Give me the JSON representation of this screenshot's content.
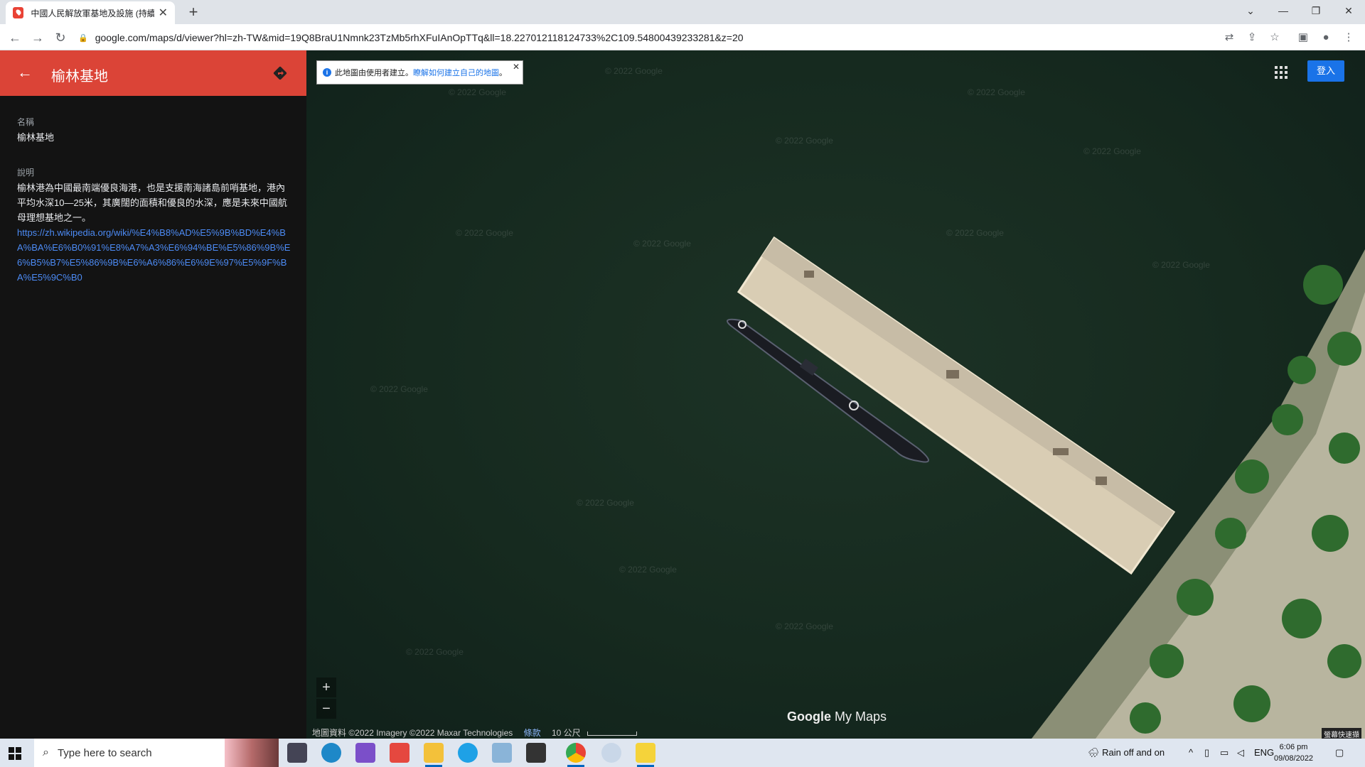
{
  "browser": {
    "tab_title": "中國人民解放軍基地及設施 (持續",
    "tab_close": "✕",
    "new_tab": "+",
    "url": "google.com/maps/d/viewer?hl=zh-TW&mid=19Q8BraU1Nmnk23TzMb5rhXFuIAnOpTTq&ll=18.227012118124733%2C109.54800439233281&z=20",
    "win_controls": [
      "⌄",
      "—",
      "❐",
      "✕"
    ]
  },
  "panel": {
    "title": "榆林基地",
    "name_label": "名稱",
    "name_value": "榆林基地",
    "desc_label": "說明",
    "desc_text": "榆林港為中國最南端優良海港，也是支援南海諸島前哨基地，港內平均水深10—25米，其廣闊的面積和優良的水深，應是未來中國航母理想基地之一。",
    "desc_link": "https://zh.wikipedia.org/wiki/%E4%B8%AD%E5%9B%BD%E4%BA%BA%E6%B0%91%E8%A7%A3%E6%94%BE%E5%86%9B%E6%B5%B7%E5%86%9B%E6%A6%86%E6%9E%97%E5%9F%BA%E5%9C%B0"
  },
  "map": {
    "info_text": "此地圖由使用者建立。",
    "info_link": "瞭解如何建立自己的地圖",
    "info_tail": "。",
    "signin_label": "登入",
    "zoom_in": "+",
    "zoom_out": "−",
    "attribution": "地圖資料 ©2022 Imagery ©2022 Maxar Technologies",
    "terms": "條款",
    "scale": "10 公尺",
    "logo_google": "Google",
    "logo_mymaps": "My Maps",
    "watermark": "© 2022 Google",
    "corner_badge": "螢幕快速擷"
  },
  "taskbar": {
    "search_placeholder": "Type here to search",
    "weather": "Rain off and on",
    "lang": "ENG",
    "time": "6:06 pm",
    "date": "09/08/2022"
  },
  "colors": {
    "panel_header": "#db4437",
    "signin": "#1a73e8",
    "link": "#4c8bf5"
  }
}
